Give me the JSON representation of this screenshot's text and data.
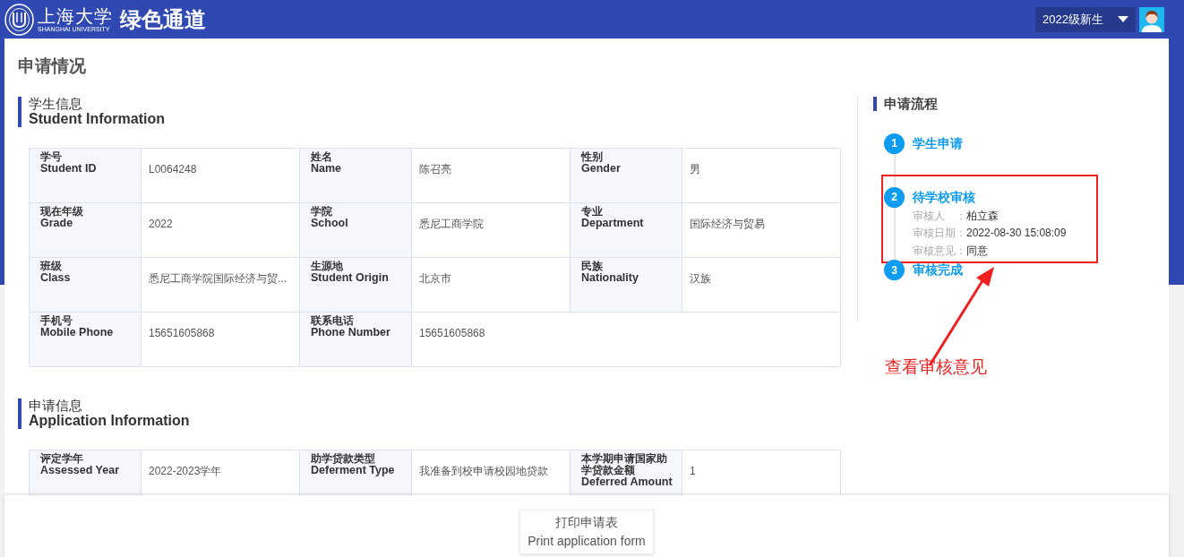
{
  "header": {
    "logo_name": "上海大学",
    "logo_subtitle": "SHANGHAI UNIVERSITY",
    "app_title": "绿色通道",
    "user_menu": "2022级新生"
  },
  "page_title": "申请情况",
  "student_info": {
    "title_cn": "学生信息",
    "title_en": "Student Information",
    "rows": [
      [
        {
          "label_cn": "学号",
          "label_en": "Student ID",
          "value": "L0064248"
        },
        {
          "label_cn": "姓名",
          "label_en": "Name",
          "value": "陈召亮"
        },
        {
          "label_cn": "性别",
          "label_en": "Gender",
          "value": "男"
        }
      ],
      [
        {
          "label_cn": "现在年级",
          "label_en": "Grade",
          "value": "2022"
        },
        {
          "label_cn": "学院",
          "label_en": "School",
          "value": "悉尼工商学院"
        },
        {
          "label_cn": "专业",
          "label_en": "Department",
          "value": "国际经济与贸易"
        }
      ],
      [
        {
          "label_cn": "班级",
          "label_en": "Class",
          "value": "悉尼工商学院国际经济与贸..."
        },
        {
          "label_cn": "生源地",
          "label_en": "Student Origin",
          "value": "北京市"
        },
        {
          "label_cn": "民族",
          "label_en": "Nationality",
          "value": "汉族"
        }
      ],
      [
        {
          "label_cn": "手机号",
          "label_en": "Mobile Phone",
          "value": "15651605868"
        },
        {
          "label_cn": "联系电话",
          "label_en": "Phone Number",
          "value": "15651605868"
        }
      ]
    ]
  },
  "application_info": {
    "title_cn": "申请信息",
    "title_en": "Application Information",
    "rows": [
      [
        {
          "label_cn": "评定学年",
          "label_en": "Assessed Year",
          "value": "2022-2023学年"
        },
        {
          "label_cn": "助学贷款类型",
          "label_en": "Deferment Type",
          "value": "我准备到校申请校园地贷款"
        },
        {
          "label_cn": "本学期申请国家助学贷款金额",
          "label_en": "Deferred Amount",
          "value": "1"
        }
      ]
    ]
  },
  "process": {
    "title": "申请流程",
    "steps": [
      {
        "number": "1",
        "title": "学生申请"
      },
      {
        "number": "2",
        "title": "待学校审核",
        "highlighted": true,
        "details": [
          {
            "label": "审核人　：",
            "value": "柏立森"
          },
          {
            "label": "审核日期：",
            "value": "2022-08-30 15:08:09"
          },
          {
            "label": "审核意见：",
            "value": "同意"
          }
        ]
      },
      {
        "number": "3",
        "title": "审核完成"
      }
    ]
  },
  "annotation": {
    "text": "查看审核意见"
  },
  "footer": {
    "print_button": {
      "label_cn": "打印申请表",
      "label_en": "Print application form"
    }
  }
}
